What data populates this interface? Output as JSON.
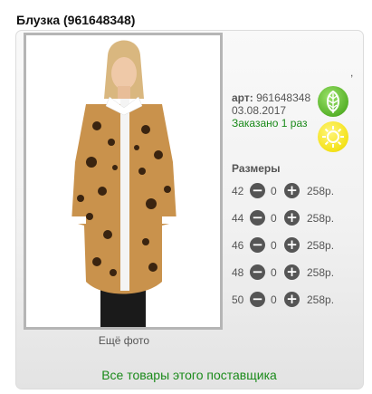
{
  "product": {
    "title": "Блузка (961648348)",
    "article_label": "арт:",
    "article": "961648348",
    "date": "03.08.2017",
    "ordered": "Заказано 1 раз",
    "tick": ","
  },
  "photo": {
    "more_label": "Ещё фото"
  },
  "badges": {
    "leaf_icon": "leaf-icon",
    "sun_icon": "sun-icon",
    "leaf_color": "#58b22a",
    "sun_color": "#f4e21a"
  },
  "sizes": {
    "title": "Размеры",
    "rows": [
      {
        "size": "42",
        "qty": "0",
        "price": "258р."
      },
      {
        "size": "44",
        "qty": "0",
        "price": "258р."
      },
      {
        "size": "46",
        "qty": "0",
        "price": "258р."
      },
      {
        "size": "48",
        "qty": "0",
        "price": "258р."
      },
      {
        "size": "50",
        "qty": "0",
        "price": "258р."
      }
    ],
    "minus_symbol": "−",
    "plus_symbol": "+"
  },
  "footer": {
    "supplier_link": "Все товары этого поставщика"
  }
}
